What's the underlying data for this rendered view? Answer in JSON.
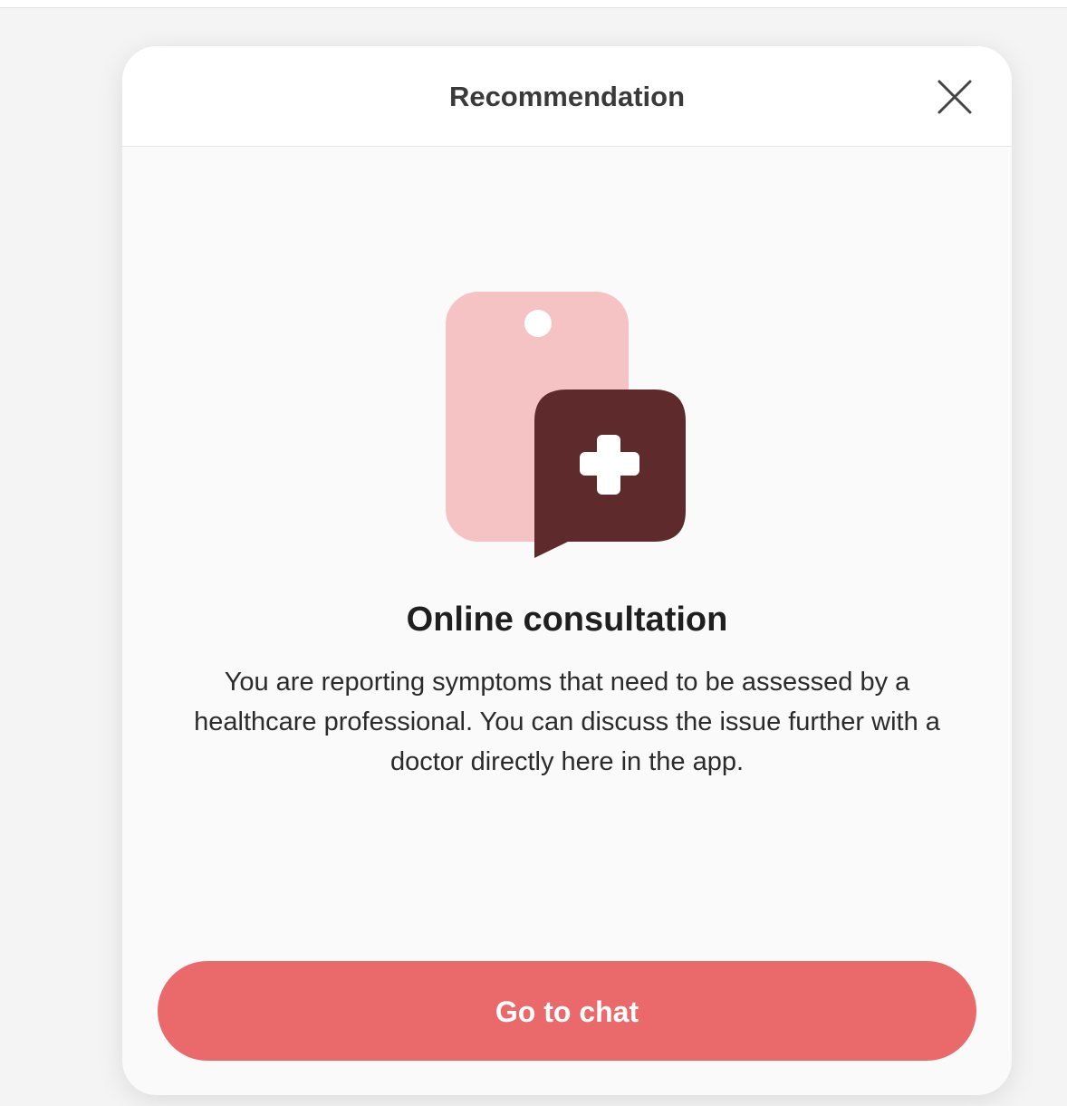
{
  "modal": {
    "title": "Recommendation",
    "close_icon": "close-icon"
  },
  "illustration": {
    "phone_icon": "phone-icon",
    "chat_icon": "medical-chat-icon",
    "colors": {
      "phone": "#f5c3c3",
      "chat_bubble": "#5e2a2b",
      "cross": "#ffffff"
    }
  },
  "content": {
    "headline": "Online consultation",
    "description": "You are reporting symptoms that need to be assessed by a healthcare professional. You can discuss the issue further with a doctor directly here in the app."
  },
  "actions": {
    "primary_label": "Go to chat",
    "primary_color": "#ea6a6b"
  }
}
